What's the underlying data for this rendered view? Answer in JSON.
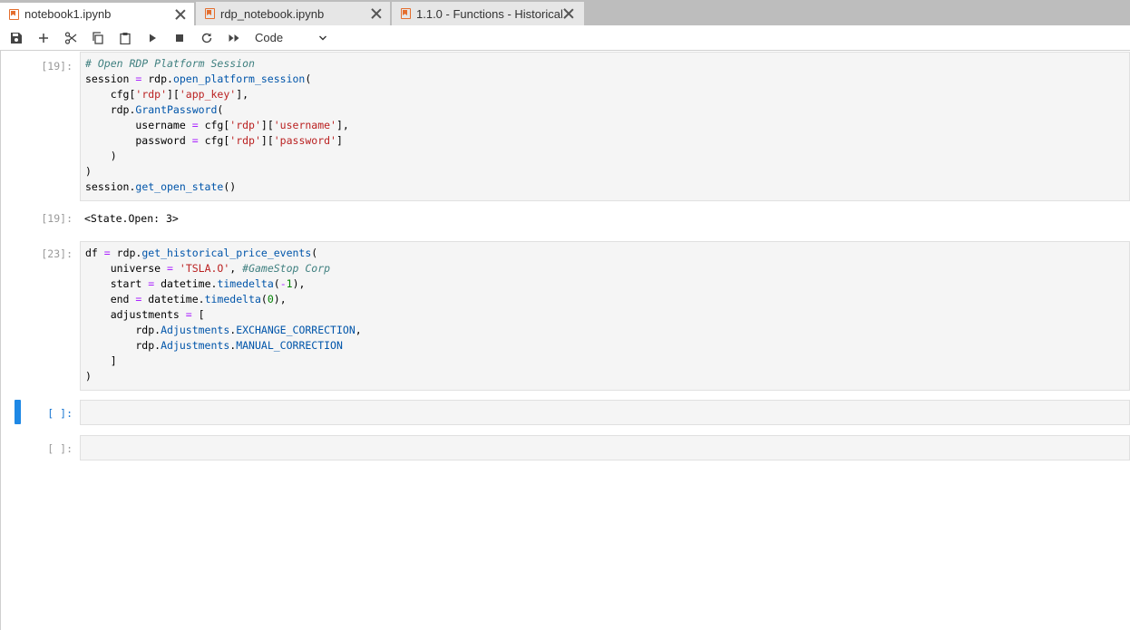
{
  "tabs": [
    {
      "label": "notebook1.ipynb",
      "active": true
    },
    {
      "label": "rdp_notebook.ipynb",
      "active": false
    },
    {
      "label": "1.1.0 - Functions - Historical",
      "active": false
    }
  ],
  "toolbar": {
    "buttons": [
      "save-icon",
      "add-cell-icon",
      "cut-icon",
      "copy-icon",
      "paste-icon",
      "run-icon",
      "stop-icon",
      "restart-icon",
      "run-all-icon"
    ],
    "cell_type": "Code"
  },
  "cells": [
    {
      "prompt": "[19]:",
      "code_lines": [
        "# Open RDP Platform Session",
        "session = rdp.open_platform_session(",
        "    cfg['rdp']['app_key'],",
        "    rdp.GrantPassword(",
        "        username = cfg['rdp']['username'],",
        "        password = cfg['rdp']['password']",
        "    )",
        ")",
        "session.get_open_state()"
      ],
      "output_prompt": "[19]:",
      "output": "<State.Open: 3>"
    },
    {
      "prompt": "[23]:",
      "code_lines": [
        "df = rdp.get_historical_price_events(",
        "    universe = 'TSLA.O', #GameStop Corp",
        "    start = datetime.timedelta(-1),",
        "    end = datetime.timedelta(0),",
        "    adjustments = [",
        "        rdp.Adjustments.EXCHANGE_CORRECTION,",
        "        rdp.Adjustments.MANUAL_CORRECTION",
        "    ]",
        ")"
      ]
    },
    {
      "prompt": "[ ]:",
      "code_lines": [],
      "active": true
    },
    {
      "prompt": "[ ]:",
      "code_lines": []
    }
  ],
  "colors": {
    "active_accent": "#1e88e5",
    "notebook_icon": "#e46e2e",
    "editor_bg": "#f5f5f5"
  }
}
